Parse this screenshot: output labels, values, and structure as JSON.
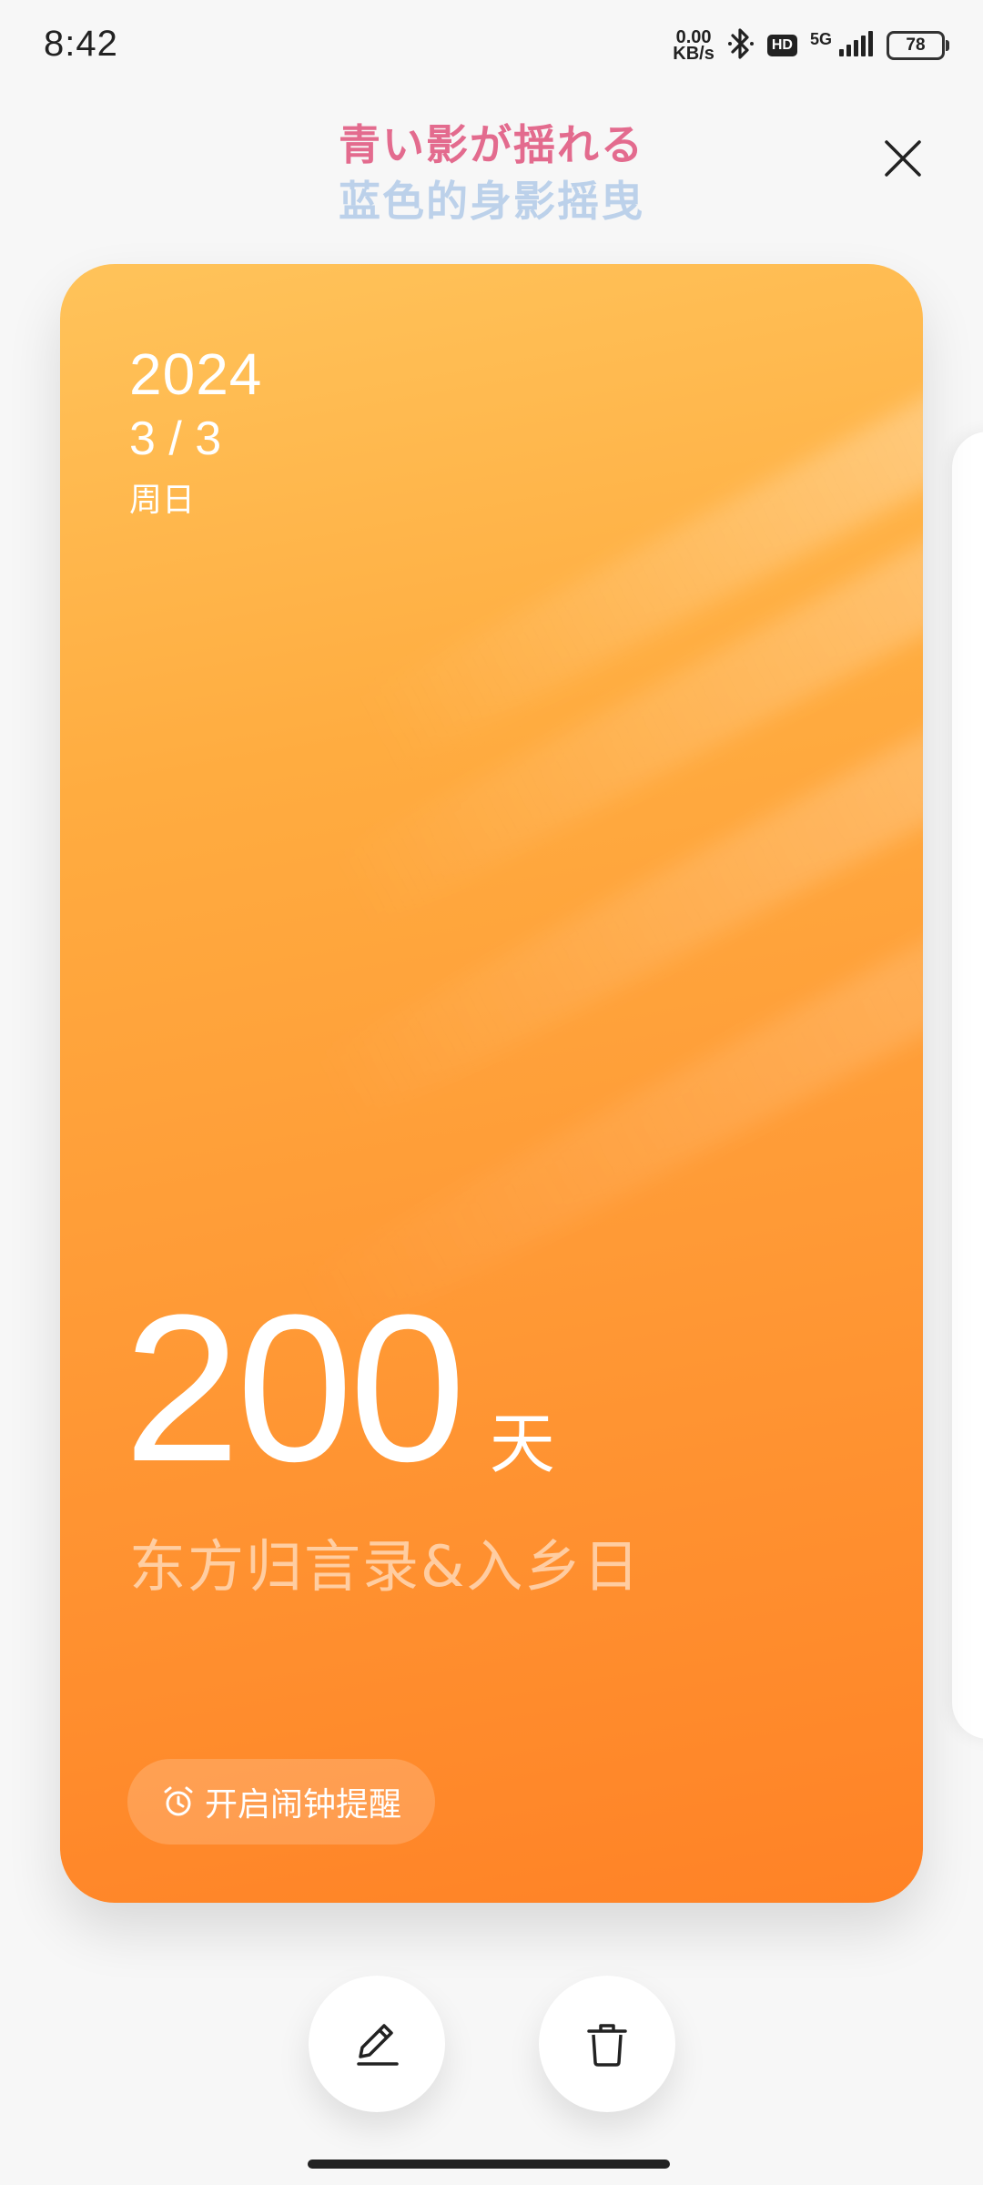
{
  "status_bar": {
    "time": "8:42",
    "net_speed_value": "0.00",
    "net_speed_unit": "KB/s",
    "hd_label": "HD",
    "network_type": "5G",
    "battery": "78"
  },
  "header": {
    "title_jp": "青い影が揺れる",
    "title_cn": "蓝色的身影摇曳"
  },
  "card": {
    "year": "2024",
    "date": "3 / 3",
    "weekday": "周日",
    "days_count": "200",
    "days_unit": "天",
    "event_name": "东方归言录&入乡日",
    "alarm_label": "开启闹钟提醒",
    "gradient_colors": [
      "#ffc35a",
      "#ffac40",
      "#ff9a36",
      "#ff8226"
    ]
  },
  "icons": {
    "close": "close-icon",
    "alarm": "alarm-clock-icon",
    "edit": "pencil-icon",
    "delete": "trash-icon",
    "bluetooth": "bluetooth-icon",
    "signal": "signal-bars-icon",
    "battery": "battery-icon"
  },
  "colors": {
    "title_jp": "#e36b8e",
    "title_cn": "#bcd1ea",
    "background": "#f7f7f7"
  }
}
